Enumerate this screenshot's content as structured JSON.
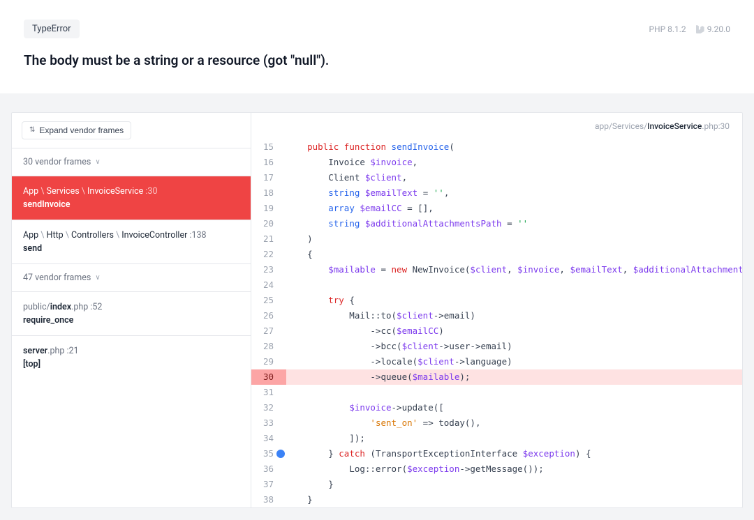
{
  "header": {
    "exception_type": "TypeError",
    "message": "The body must be a string or a resource (got \"null\").",
    "php_label": "PHP 8.1.2",
    "laravel_label": "9.20.0"
  },
  "sidebar": {
    "expand_label": "Expand vendor frames",
    "groups": [
      {
        "kind": "vendor",
        "label": "30 vendor frames"
      },
      {
        "kind": "frame",
        "active": true,
        "path_parts": [
          "App",
          "Services",
          "InvoiceService"
        ],
        "line": 30,
        "method": "sendInvoice"
      },
      {
        "kind": "frame",
        "active": false,
        "path_parts": [
          "App",
          "Http",
          "Controllers",
          "InvoiceController"
        ],
        "line": 138,
        "method": "send"
      },
      {
        "kind": "vendor",
        "label": "47 vendor frames"
      },
      {
        "kind": "frame",
        "active": false,
        "path_file": {
          "dir": "public/",
          "strong": "index",
          "ext": ".php"
        },
        "line": 52,
        "method": "require_once"
      },
      {
        "kind": "frame",
        "active": false,
        "path_file": {
          "dir": "",
          "strong": "server",
          "ext": ".php"
        },
        "line": 21,
        "method": "[top]"
      }
    ]
  },
  "code": {
    "file": {
      "dir": "app/Services/",
      "name": "InvoiceService",
      "ext": ".php",
      "line": 30
    },
    "highlight_line": 30,
    "breakpoint_line": 35,
    "lines": [
      {
        "n": 15,
        "tokens": [
          [
            "plain",
            "    "
          ],
          [
            "kw-red",
            "public"
          ],
          [
            "plain",
            " "
          ],
          [
            "kw-red",
            "function"
          ],
          [
            "plain",
            " "
          ],
          [
            "kw-blue",
            "sendInvoice"
          ],
          [
            "plain",
            "("
          ]
        ]
      },
      {
        "n": 16,
        "tokens": [
          [
            "plain",
            "        Invoice "
          ],
          [
            "var",
            "$invoice"
          ],
          [
            "plain",
            ","
          ]
        ]
      },
      {
        "n": 17,
        "tokens": [
          [
            "plain",
            "        Client "
          ],
          [
            "var",
            "$client"
          ],
          [
            "plain",
            ","
          ]
        ]
      },
      {
        "n": 18,
        "tokens": [
          [
            "plain",
            "        "
          ],
          [
            "kw-blue",
            "string"
          ],
          [
            "plain",
            " "
          ],
          [
            "var",
            "$emailText"
          ],
          [
            "plain",
            " = "
          ],
          [
            "str",
            "''"
          ],
          [
            "plain",
            ","
          ]
        ]
      },
      {
        "n": 19,
        "tokens": [
          [
            "plain",
            "        "
          ],
          [
            "kw-blue",
            "array"
          ],
          [
            "plain",
            " "
          ],
          [
            "var",
            "$emailCC"
          ],
          [
            "plain",
            " = [],"
          ]
        ]
      },
      {
        "n": 20,
        "tokens": [
          [
            "plain",
            "        "
          ],
          [
            "kw-blue",
            "string"
          ],
          [
            "plain",
            " "
          ],
          [
            "var",
            "$additionalAttachmentsPath"
          ],
          [
            "plain",
            " = "
          ],
          [
            "str",
            "''"
          ]
        ]
      },
      {
        "n": 21,
        "tokens": [
          [
            "plain",
            "    )"
          ]
        ]
      },
      {
        "n": 22,
        "tokens": [
          [
            "plain",
            "    {"
          ]
        ]
      },
      {
        "n": 23,
        "tokens": [
          [
            "plain",
            "        "
          ],
          [
            "var",
            "$mailable"
          ],
          [
            "plain",
            " = "
          ],
          [
            "kw-red",
            "new"
          ],
          [
            "plain",
            " NewInvoice("
          ],
          [
            "var",
            "$client"
          ],
          [
            "plain",
            ", "
          ],
          [
            "var",
            "$invoice"
          ],
          [
            "plain",
            ", "
          ],
          [
            "var",
            "$emailText"
          ],
          [
            "plain",
            ", "
          ],
          [
            "var",
            "$additionalAttachmentsPath"
          ],
          [
            "plain",
            ");"
          ]
        ]
      },
      {
        "n": 24,
        "tokens": [
          [
            "plain",
            ""
          ]
        ]
      },
      {
        "n": 25,
        "tokens": [
          [
            "plain",
            "        "
          ],
          [
            "kw-red",
            "try"
          ],
          [
            "plain",
            " {"
          ]
        ]
      },
      {
        "n": 26,
        "tokens": [
          [
            "plain",
            "            Mail::to("
          ],
          [
            "var",
            "$client"
          ],
          [
            "plain",
            "->email)"
          ]
        ]
      },
      {
        "n": 27,
        "tokens": [
          [
            "plain",
            "                ->cc("
          ],
          [
            "var",
            "$emailCC"
          ],
          [
            "plain",
            ")"
          ]
        ]
      },
      {
        "n": 28,
        "tokens": [
          [
            "plain",
            "                ->bcc("
          ],
          [
            "var",
            "$client"
          ],
          [
            "plain",
            "->user->email)"
          ]
        ]
      },
      {
        "n": 29,
        "tokens": [
          [
            "plain",
            "                ->locale("
          ],
          [
            "var",
            "$client"
          ],
          [
            "plain",
            "->language)"
          ]
        ]
      },
      {
        "n": 30,
        "tokens": [
          [
            "plain",
            "                ->queue("
          ],
          [
            "var",
            "$mailable"
          ],
          [
            "plain",
            ");"
          ]
        ]
      },
      {
        "n": 31,
        "tokens": [
          [
            "plain",
            ""
          ]
        ]
      },
      {
        "n": 32,
        "tokens": [
          [
            "plain",
            "            "
          ],
          [
            "var",
            "$invoice"
          ],
          [
            "plain",
            "->update(["
          ]
        ]
      },
      {
        "n": 33,
        "tokens": [
          [
            "plain",
            "                "
          ],
          [
            "str-orange",
            "'sent_on'"
          ],
          [
            "plain",
            " => today(),"
          ]
        ]
      },
      {
        "n": 34,
        "tokens": [
          [
            "plain",
            "            ]);"
          ]
        ]
      },
      {
        "n": 35,
        "tokens": [
          [
            "plain",
            "        } "
          ],
          [
            "kw-red",
            "catch"
          ],
          [
            "plain",
            " (TransportExceptionInterface "
          ],
          [
            "var",
            "$exception"
          ],
          [
            "plain",
            ") {"
          ]
        ]
      },
      {
        "n": 36,
        "tokens": [
          [
            "plain",
            "            Log::error("
          ],
          [
            "var",
            "$exception"
          ],
          [
            "plain",
            "->getMessage());"
          ]
        ]
      },
      {
        "n": 37,
        "tokens": [
          [
            "plain",
            "        }"
          ]
        ]
      },
      {
        "n": 38,
        "tokens": [
          [
            "plain",
            "    }"
          ]
        ]
      }
    ]
  }
}
